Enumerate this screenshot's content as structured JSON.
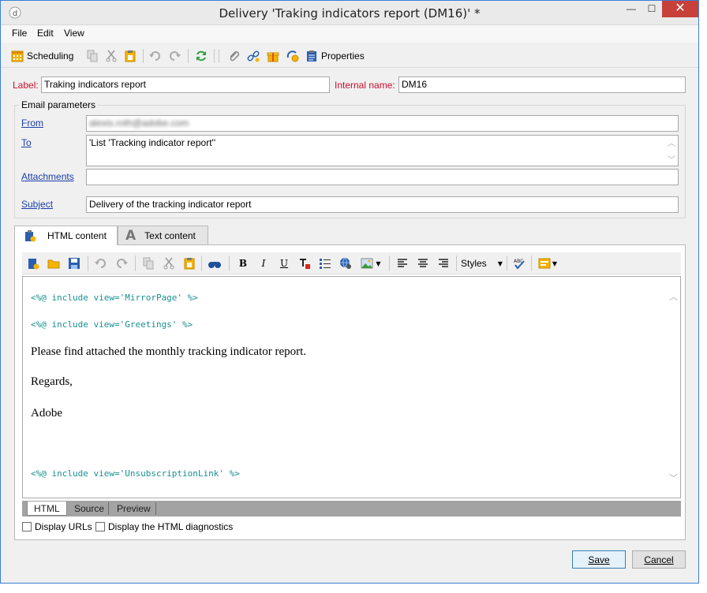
{
  "window": {
    "title": "Delivery 'Traking indicators report (DM16)' *",
    "controls": {
      "minimize": "—",
      "maximize": "☐",
      "close": "✕"
    }
  },
  "menu": {
    "items": [
      "File",
      "Edit",
      "View"
    ]
  },
  "toolbar": {
    "scheduling_label": "Scheduling",
    "properties_label": "Properties"
  },
  "form": {
    "label_caption": "Label:",
    "label_value": "Traking indicators report",
    "internal_name_caption": "Internal name:",
    "internal_name_value": "DM16",
    "email_params_title": "Email parameters",
    "from_caption": "From",
    "from_value": "alexis.roth@adobe.com",
    "to_caption": "To",
    "to_value": "'List 'Tracking indicator report''",
    "attachments_caption": "Attachments",
    "attachments_value": "",
    "subject_caption": "Subject",
    "subject_value": "Delivery of the tracking indicator report"
  },
  "content_tabs": {
    "html": "HTML content",
    "text": "Text content"
  },
  "editor_toolbar": {
    "styles_label": "Styles"
  },
  "editor": {
    "line1": "<%@ include view='MirrorPage' %>",
    "line2": "<%@ include view='Greetings' %>",
    "para1": "Please find attached the monthly tracking indicator report.",
    "para2": "Regards,",
    "para3": "Adobe",
    "line3": "<%@ include view='UnsubscriptionLink' %>"
  },
  "view_tabs": {
    "html": "HTML",
    "source": "Source",
    "preview": "Preview"
  },
  "options": {
    "display_urls": "Display URLs",
    "display_diagnostics": "Display the HTML diagnostics"
  },
  "footer": {
    "save": "Save",
    "cancel": "Cancel"
  },
  "colors": {
    "accent_red": "#c8102e",
    "link_blue": "#1a3fa8",
    "code_teal": "#1a8f8f",
    "close_red": "#c7413a"
  }
}
